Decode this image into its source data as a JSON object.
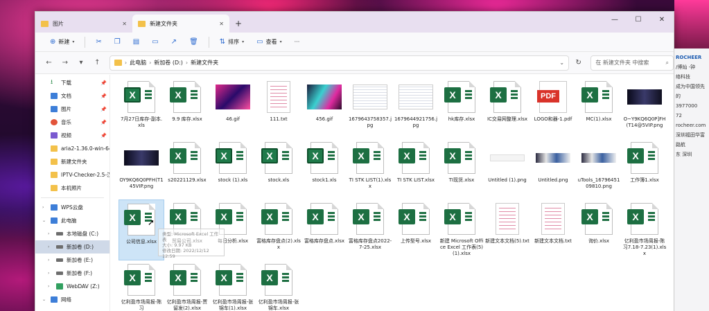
{
  "tabs": [
    {
      "label": "图片",
      "active": false
    },
    {
      "label": "新建文件夹",
      "active": true
    }
  ],
  "window_controls": {
    "minimize": "—",
    "maximize": "☐",
    "close": "✕"
  },
  "toolbar": {
    "new_label": "新建",
    "sort_label": "排序",
    "view_label": "查看",
    "more_label": "···"
  },
  "address": {
    "crumbs": [
      "此电脑",
      "新加卷 (D:)",
      "新建文件夹"
    ],
    "search_placeholder": "在 新建文件夹 中搜索"
  },
  "sidebar": {
    "quick": [
      {
        "label": "下载",
        "icon": "download-icon"
      },
      {
        "label": "文档",
        "icon": "document-icon"
      },
      {
        "label": "图片",
        "icon": "pictures-icon"
      },
      {
        "label": "音乐",
        "icon": "music-icon"
      },
      {
        "label": "视频",
        "icon": "video-icon"
      },
      {
        "label": "aria2-1.36.0-win-64b",
        "icon": "folder-icon"
      },
      {
        "label": "新建文件夹",
        "icon": "folder-icon"
      },
      {
        "label": "IPTV-Checker-2.5-汉",
        "icon": "folder-icon"
      },
      {
        "label": "本机照片",
        "icon": "folder-icon"
      }
    ],
    "wps": "WPS云盘",
    "pc": "此电脑",
    "drives": [
      "本地磁盘 (C:)",
      "新加卷 (D:)",
      "新加卷 (E:)",
      "新加卷 (F:)",
      "WebDAV (Z:)"
    ],
    "network": "网络"
  },
  "files": [
    {
      "name": "7月27日库存-副本.xls",
      "type": "xls"
    },
    {
      "name": "9.9 库存.xlsx",
      "type": "xlsx"
    },
    {
      "name": "46.gif",
      "type": "neon"
    },
    {
      "name": "111.txt",
      "type": "txt"
    },
    {
      "name": "456.gif",
      "type": "neon2"
    },
    {
      "name": "1679643758357.jpg",
      "type": "sheet"
    },
    {
      "name": "1679644921756.jpg",
      "type": "sheet"
    },
    {
      "name": "hk库存.xlsx",
      "type": "xlsx"
    },
    {
      "name": "IC交易网整理.xlsx",
      "type": "xlsx"
    },
    {
      "name": "LOGO和器-1.pdf",
      "type": "pdf"
    },
    {
      "name": "MC(1).xlsx",
      "type": "xlsx"
    },
    {
      "name": "O~Y9KQ6Q0P]FH(T14@5VIP.png",
      "type": "dark"
    },
    {
      "name": "OY9KQ6Q0PFH(T145VIP.png",
      "type": "dark"
    },
    {
      "name": "s20221129.xlsx",
      "type": "xlsx"
    },
    {
      "name": "stock (1).xls",
      "type": "xls"
    },
    {
      "name": "stock.xls",
      "type": "xls"
    },
    {
      "name": "stock1.xls",
      "type": "xls"
    },
    {
      "name": "TI STK LIST(1).xlsx",
      "type": "xlsx"
    },
    {
      "name": "TI STK LIST.xlsx",
      "type": "xlsx"
    },
    {
      "name": "TI现货.xlsx",
      "type": "xlsx"
    },
    {
      "name": "Untitled (1).png",
      "type": "white"
    },
    {
      "name": "Untitled.png",
      "type": "strip"
    },
    {
      "name": "uTools_1679645109810.png",
      "type": "strip"
    },
    {
      "name": "工作簿1.xlsx",
      "type": "xlsx"
    },
    {
      "name": "公司信息.xlsx",
      "type": "xlsx",
      "selected": true
    },
    {
      "name": "贸易公司.xlsx",
      "type": "xlsx"
    },
    {
      "name": "每日分析.xlsx",
      "type": "xlsx"
    },
    {
      "name": "富格库存盘点(2).xlsx",
      "type": "xlsx"
    },
    {
      "name": "富格库存盘点.xlsx",
      "type": "xlsx"
    },
    {
      "name": "富格库存盘点2022-7-25.xlsx",
      "type": "xlsx"
    },
    {
      "name": "上传型号.xlsx",
      "type": "xlsx"
    },
    {
      "name": "新建 Microsoft Office Excel 工作表(5)(1).xlsx",
      "type": "xlsx"
    },
    {
      "name": "新建文本文档(5).txt",
      "type": "txt"
    },
    {
      "name": "新建文本文档.txt",
      "type": "txt"
    },
    {
      "name": "询价.xlsx",
      "type": "xlsx"
    },
    {
      "name": "亿利盈市场周报-陈习7.18-7.23(1).xlsx",
      "type": "xlsx"
    },
    {
      "name": "亿利盈市场周报-陈习",
      "type": "xlsx"
    },
    {
      "name": "亿利盈市场周报-贾留发(2).xlsx",
      "type": "xlsx"
    },
    {
      "name": "亿利盈市场周报-张锦车(1).xlsx",
      "type": "xlsx"
    },
    {
      "name": "亿利盈市场周报-张锦车.xlsx",
      "type": "xlsx"
    }
  ],
  "tooltip": {
    "line1": "类型: Microsoft Excel 工作表",
    "line2": "大小: 9.97 KB",
    "line3": "修改日期: 2022/12/12 12:59"
  },
  "right_panel": {
    "brand": "ROCHEER",
    "lines": [
      "/博灿 -钟",
      "络科技",
      "成为中国领先的",
      "3977000",
      "72",
      "rocheer.com",
      "深圳福田华富路航",
      "东 深圳"
    ]
  }
}
